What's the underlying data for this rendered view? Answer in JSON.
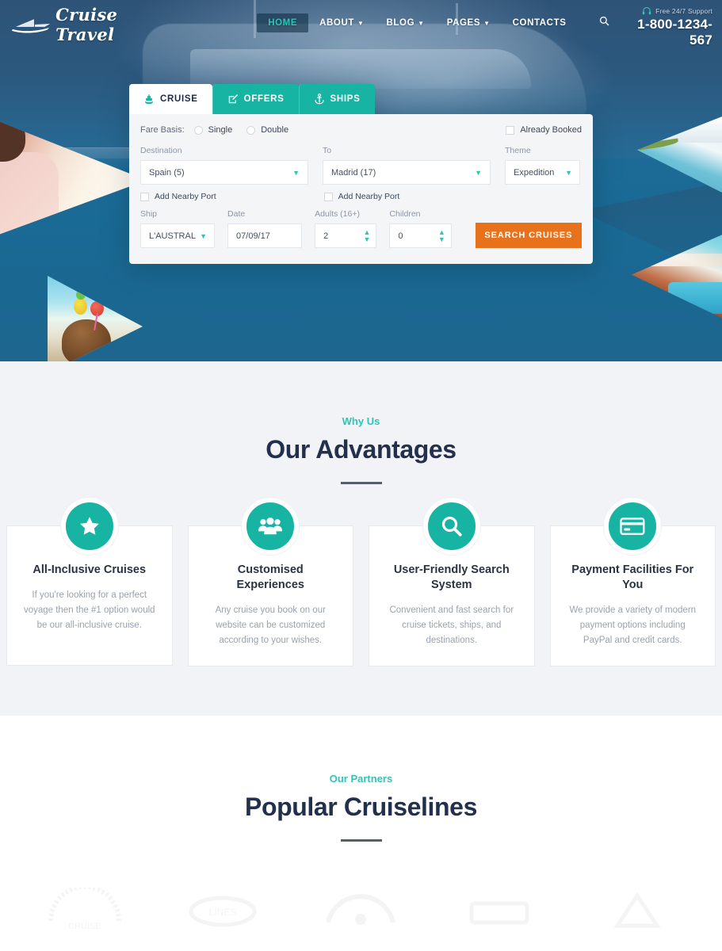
{
  "header": {
    "logo_text": "Cruise Travel",
    "logo_icon": "cruise-ship-logo-icon",
    "nav": [
      {
        "label": "HOME",
        "active": true,
        "has_caret": false
      },
      {
        "label": "ABOUT",
        "active": false,
        "has_caret": true
      },
      {
        "label": "BLOG",
        "active": false,
        "has_caret": true
      },
      {
        "label": "PAGES",
        "active": false,
        "has_caret": true
      },
      {
        "label": "CONTACTS",
        "active": false,
        "has_caret": false
      }
    ],
    "search_icon": "search-icon",
    "support_icon": "headset-icon",
    "support_label": "Free 24/7 Support",
    "support_phone": "1-800-1234-567"
  },
  "search_widget": {
    "tabs": [
      {
        "label": "CRUISE",
        "icon": "ship-icon",
        "active": true
      },
      {
        "label": "OFFERS",
        "icon": "pencil-square-icon",
        "active": false
      },
      {
        "label": "SHIPS",
        "icon": "anchor-icon",
        "active": false
      }
    ],
    "fare_basis_label": "Fare Basis:",
    "fare_options": [
      {
        "label": "Single",
        "selected": false
      },
      {
        "label": "Double",
        "selected": false
      }
    ],
    "already_booked": {
      "label": "Already Booked",
      "checked": false
    },
    "destination": {
      "label": "Destination",
      "value": "Spain (5)"
    },
    "to": {
      "label": "To",
      "value": "Madrid (17)"
    },
    "theme": {
      "label": "Theme",
      "value": "Expedition"
    },
    "nearby_port_from": {
      "label": "Add Nearby Port",
      "checked": false
    },
    "nearby_port_to": {
      "label": "Add Nearby Port",
      "checked": false
    },
    "ship": {
      "label": "Ship",
      "value": "L'AUSTRAL"
    },
    "date": {
      "label": "Date",
      "value": "07/09/17"
    },
    "adults": {
      "label": "Adults (16+)",
      "value": "2"
    },
    "children": {
      "label": "Children",
      "value": "0"
    },
    "search_button": "SEARCH CRUISES",
    "accent_color": "#17b3a3",
    "button_color": "#e8721c"
  },
  "advantages": {
    "eyebrow": "Why Us",
    "title": "Our Advantages",
    "cards": [
      {
        "icon": "star-icon",
        "title": "All-Inclusive Cruises",
        "text": "If you're looking for a perfect voyage then the #1 option would be our all-inclusive cruise."
      },
      {
        "icon": "people-group-icon",
        "title": "Customised Experiences",
        "text": "Any cruise you book on our website can be customized according to your wishes."
      },
      {
        "icon": "magnifier-icon",
        "title": "User-Friendly Search System",
        "text": "Convenient and fast search for cruise tickets, ships, and destinations."
      },
      {
        "icon": "credit-card-icon",
        "title": "Payment Facilities For You",
        "text": "We provide a variety of modern payment options including PayPal and credit cards."
      }
    ]
  },
  "partners": {
    "eyebrow": "Our Partners",
    "title": "Popular Cruiselines"
  }
}
